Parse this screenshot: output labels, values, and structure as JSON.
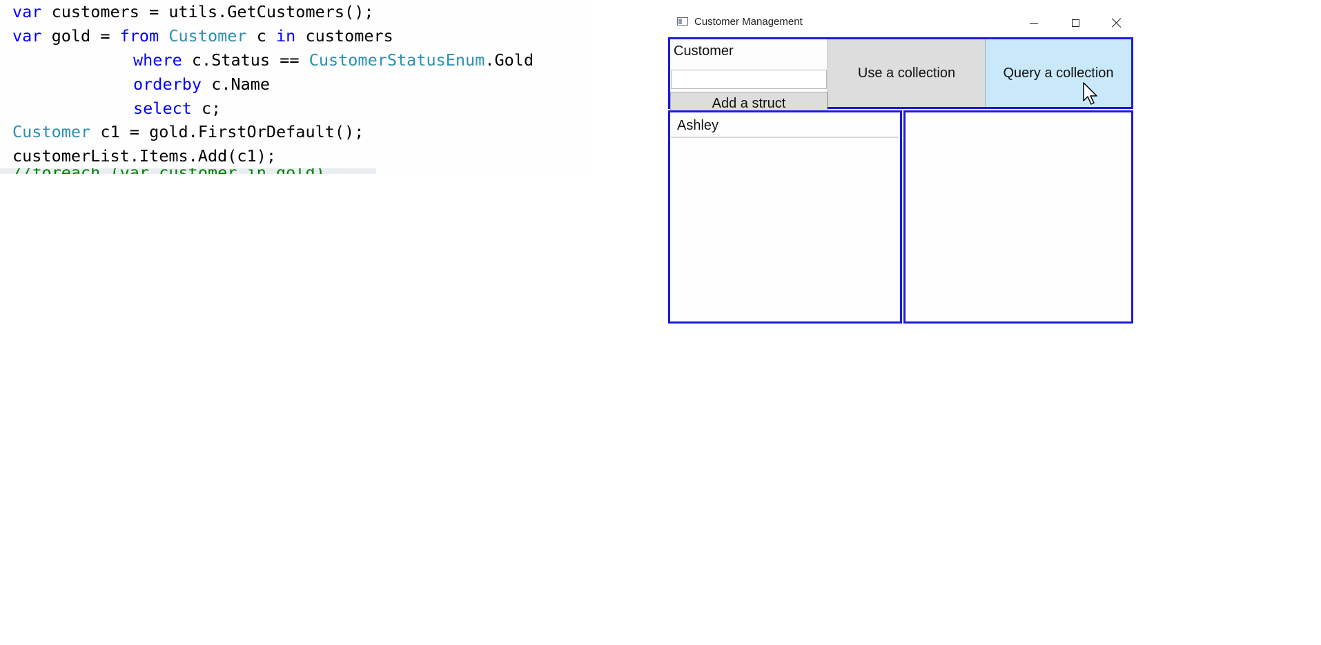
{
  "code_editor": {
    "lines": [
      {
        "tokens": [
          {
            "t": "var",
            "k": "kw"
          },
          {
            "t": " customers = utils.GetCustomers();",
            "k": "plain"
          }
        ]
      },
      {
        "tokens": [
          {
            "t": "var",
            "k": "kw"
          },
          {
            "t": " gold = ",
            "k": "plain"
          },
          {
            "t": "from",
            "k": "kw"
          },
          {
            "t": " ",
            "k": "plain"
          },
          {
            "t": "Customer",
            "k": "ty"
          },
          {
            "t": " c ",
            "k": "plain"
          },
          {
            "t": "in",
            "k": "kw"
          },
          {
            "t": " customers",
            "k": "plain"
          }
        ]
      },
      {
        "tokens": [
          {
            "t": "where",
            "k": "kw"
          },
          {
            "t": " c.Status == ",
            "k": "plain"
          },
          {
            "t": "CustomerStatusEnum",
            "k": "ty"
          },
          {
            "t": ".Gold",
            "k": "plain"
          }
        ]
      },
      {
        "tokens": [
          {
            "t": "orderby",
            "k": "kw"
          },
          {
            "t": " c.Name",
            "k": "plain"
          }
        ]
      },
      {
        "tokens": [
          {
            "t": "select",
            "k": "kw"
          },
          {
            "t": " c;",
            "k": "plain"
          }
        ]
      },
      {
        "tokens": [
          {
            "t": "Customer",
            "k": "ty"
          },
          {
            "t": " c1 = gold.FirstOrDefault();",
            "k": "plain"
          }
        ]
      },
      {
        "tokens": [
          {
            "t": "customerList.Items.Add(c1);",
            "k": "plain"
          }
        ]
      }
    ],
    "partial_line": "//foreach (var customer in gold)"
  },
  "window": {
    "title": "Customer Management",
    "label_customer": "Customer",
    "name_input_value": "",
    "add_struct_label": "Add a struct",
    "use_collection_label": "Use a collection",
    "query_collection_label": "Query a collection",
    "customer_list": [
      "Ashley"
    ],
    "accent_color": "#1a1ae0",
    "hover_color": "#c9e9fb"
  }
}
